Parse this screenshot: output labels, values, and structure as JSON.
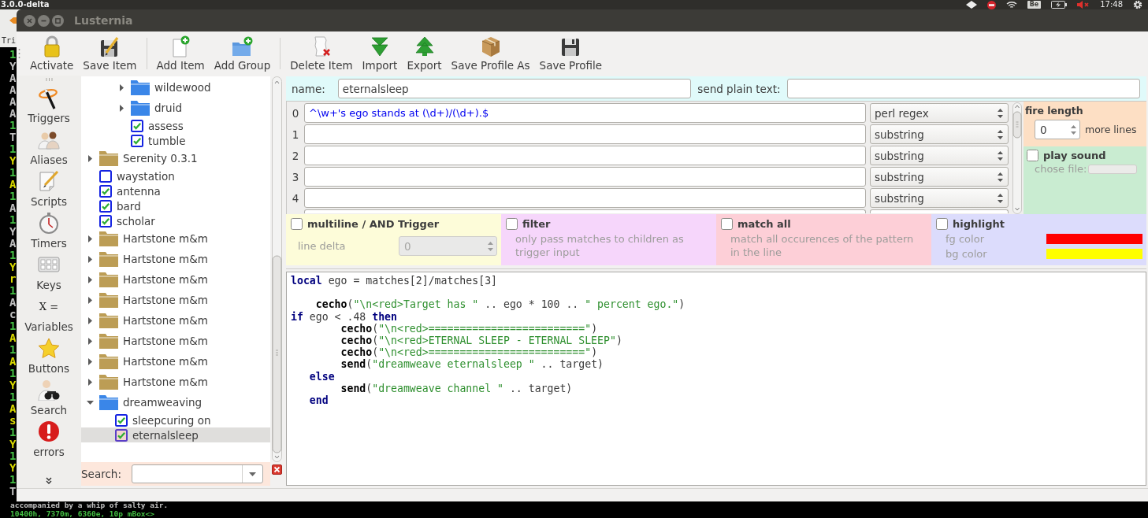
{
  "desktop_panel": {
    "title": "3.0.0-delta",
    "keyboard_layout": "Be",
    "clock": "17:48"
  },
  "background_app": {
    "tab_label": "Tri",
    "terminal_edge": [
      {
        "text": "1",
        "color": "#44c044"
      },
      {
        "text": "Y",
        "color": "#c0c0c0"
      },
      {
        "text": "A",
        "color": "#c0c0c0"
      },
      {
        "text": "A",
        "color": "#c0c0c0"
      },
      {
        "text": "A",
        "color": "#c0c0c0"
      },
      {
        "text": "A",
        "color": "#c0c0c0"
      },
      {
        "text": "1",
        "color": "#44c044"
      },
      {
        "text": "T",
        "color": "#c0c0c0"
      },
      {
        "text": "1",
        "color": "#44c044"
      },
      {
        "text": "Y",
        "color": "#d8d800"
      },
      {
        "text": "1",
        "color": "#44c044"
      },
      {
        "text": "A",
        "color": "#d8d800"
      },
      {
        "text": "1",
        "color": "#44c044"
      },
      {
        "text": "A",
        "color": "#c0c0c0"
      },
      {
        "text": "1",
        "color": "#44c044"
      },
      {
        "text": "Y",
        "color": "#c0c0c0"
      },
      {
        "text": "A",
        "color": "#c0c0c0"
      },
      {
        "text": "1",
        "color": "#44c044"
      },
      {
        "text": "Y",
        "color": "#d8d800"
      },
      {
        "text": "r",
        "color": "#d8d800"
      },
      {
        "text": "1",
        "color": "#44c044"
      },
      {
        "text": "A",
        "color": "#c0c0c0"
      },
      {
        "text": "c",
        "color": "#c0c0c0"
      },
      {
        "text": "1",
        "color": "#44c044"
      },
      {
        "text": "A",
        "color": "#d8d800"
      },
      {
        "text": "1",
        "color": "#44c044"
      },
      {
        "text": "A",
        "color": "#d8d800"
      },
      {
        "text": "1",
        "color": "#44c044"
      },
      {
        "text": "Y",
        "color": "#d8d800"
      },
      {
        "text": "1",
        "color": "#44c044"
      },
      {
        "text": "A",
        "color": "#d8d800"
      },
      {
        "text": "s",
        "color": "#d8d800"
      },
      {
        "text": "1",
        "color": "#44c044"
      },
      {
        "text": "Y",
        "color": "#d8d800"
      },
      {
        "text": "1",
        "color": "#44c044"
      },
      {
        "text": "Y",
        "color": "#d8d800"
      },
      {
        "text": "1",
        "color": "#44c044"
      },
      {
        "text": "T",
        "color": "#c0c0c0"
      }
    ],
    "terminal_lines": [
      {
        "text": "accompanied by a whip of salty air.",
        "color": "#c0c0c0"
      },
      {
        "text": "10400h, 7370m, 6360e, 10p mBox<>",
        "color": "#44c044"
      }
    ]
  },
  "window": {
    "title": "Lusternia"
  },
  "toolbar": {
    "items": [
      {
        "kind": "button",
        "label": "Activate"
      },
      {
        "kind": "button",
        "label": "Save Item"
      },
      {
        "kind": "separator"
      },
      {
        "kind": "button",
        "label": "Add Item"
      },
      {
        "kind": "button",
        "label": "Add Group"
      },
      {
        "kind": "separator"
      },
      {
        "kind": "button",
        "label": "Delete Item"
      },
      {
        "kind": "button",
        "label": "Import"
      },
      {
        "kind": "button",
        "label": "Export"
      },
      {
        "kind": "button",
        "label": "Save Profile As"
      },
      {
        "kind": "button",
        "label": "Save Profile"
      }
    ]
  },
  "sidebar": {
    "items": [
      {
        "label": "Triggers"
      },
      {
        "label": "Aliases"
      },
      {
        "label": "Scripts"
      },
      {
        "label": "Timers"
      },
      {
        "label": "Keys"
      },
      {
        "label": "Variables",
        "icon_text": "X ="
      },
      {
        "label": "Buttons"
      },
      {
        "label": "Search"
      },
      {
        "label": "errors"
      }
    ]
  },
  "tree": {
    "items": [
      {
        "kind": "scrolled_off",
        "children": [
          {
            "kind": "scrolled_off",
            "children": [
              {
                "kind": "folder",
                "label": "wildewood",
                "color": "#3a86e8",
                "expanded": false,
                "selected": false
              },
              {
                "kind": "folder",
                "label": "druid",
                "color": "#3a86e8",
                "expanded": false,
                "selected": false
              },
              {
                "kind": "item",
                "label": "assess",
                "checked": true,
                "selected": false
              },
              {
                "kind": "item",
                "label": "tumble",
                "checked": true,
                "selected": false
              }
            ]
          }
        ]
      },
      {
        "kind": "folder",
        "label": "Serenity 0.3.1",
        "color": "#bc9d55",
        "expanded": false,
        "selected": false
      },
      {
        "kind": "item",
        "label": "waystation",
        "checked": false,
        "selected": false
      },
      {
        "kind": "item",
        "label": "antenna",
        "checked": true,
        "selected": false
      },
      {
        "kind": "item",
        "label": "bard",
        "checked": true,
        "selected": false
      },
      {
        "kind": "item",
        "label": "scholar",
        "checked": true,
        "selected": false
      },
      {
        "kind": "folder",
        "label": "Hartstone m&m",
        "color": "#bc9d55",
        "expanded": false,
        "selected": false
      },
      {
        "kind": "folder",
        "label": "Hartstone m&m",
        "color": "#bc9d55",
        "expanded": false,
        "selected": false
      },
      {
        "kind": "folder",
        "label": "Hartstone m&m",
        "color": "#bc9d55",
        "expanded": false,
        "selected": false
      },
      {
        "kind": "folder",
        "label": "Hartstone m&m",
        "color": "#bc9d55",
        "expanded": false,
        "selected": false
      },
      {
        "kind": "folder",
        "label": "Hartstone m&m",
        "color": "#bc9d55",
        "expanded": false,
        "selected": false
      },
      {
        "kind": "folder",
        "label": "Hartstone m&m",
        "color": "#bc9d55",
        "expanded": false,
        "selected": false
      },
      {
        "kind": "folder",
        "label": "Hartstone m&m",
        "color": "#bc9d55",
        "expanded": false,
        "selected": false
      },
      {
        "kind": "folder",
        "label": "Hartstone m&m",
        "color": "#bc9d55",
        "expanded": false,
        "selected": false
      },
      {
        "kind": "folder",
        "label": "dreamweaving",
        "color": "#3a86e8",
        "expanded": true,
        "selected": false,
        "children": [
          {
            "kind": "item",
            "label": "sleepcuring on",
            "checked": true,
            "selected": false
          },
          {
            "kind": "item",
            "label": "eternalsleep",
            "checked": true,
            "selected": true
          }
        ]
      }
    ],
    "search": {
      "label": "Search:"
    }
  },
  "trigger": {
    "name": {
      "label": "name:",
      "value": "eternalsleep"
    },
    "send_plain_text": {
      "label": "send plain text:"
    },
    "patterns": {
      "rows": [
        {
          "number": "0",
          "pattern": "^\\w+'s ego stands at (\\d+)/(\\d+).$",
          "kind": "regex",
          "type": "perl regex"
        },
        {
          "number": "1",
          "kind": "substring",
          "type": "substring"
        },
        {
          "number": "2",
          "kind": "substring",
          "type": "substring"
        },
        {
          "number": "3",
          "kind": "substring",
          "type": "substring"
        },
        {
          "number": "4",
          "kind": "substring",
          "type": "substring"
        }
      ],
      "cut_off_row": true
    },
    "fire_length": {
      "title": "fire length",
      "value": "0",
      "unit": "more lines"
    },
    "play_sound": {
      "label": "play sound",
      "checked": false,
      "file_label": "chose file:",
      "file_disabled": true
    },
    "options": [
      {
        "kind": "multiline",
        "label": "multiline / AND Trigger",
        "checked": false,
        "field_label": "line delta",
        "value": "0",
        "disabled": true
      },
      {
        "kind": "filter",
        "label": "filter",
        "checked": false,
        "description": "only pass matches to children as trigger input"
      },
      {
        "kind": "match_all",
        "label": "match all",
        "checked": false,
        "description": "match all occurences of the pattern in the line"
      },
      {
        "kind": "highlight",
        "label": "highlight",
        "checked": false,
        "fg": {
          "label": "fg color",
          "color": "#ff0000"
        },
        "bg": {
          "label": "bg color",
          "color": "#ffff00"
        }
      }
    ]
  },
  "script": {
    "lines": [
      {
        "kind": "code",
        "tokens": [
          {
            "kind": "keyword",
            "text": "local"
          },
          {
            "kind": "plain",
            "text": " ego = matches[2]/matches[3]"
          }
        ]
      },
      {
        "kind": "blank"
      },
      {
        "kind": "code",
        "tokens": [
          {
            "kind": "function",
            "text": "    cecho"
          },
          {
            "kind": "plain",
            "text": "("
          },
          {
            "kind": "string",
            "text": "\"\\n<red>Target has \""
          },
          {
            "kind": "plain",
            "text": " .. ego * "
          },
          {
            "kind": "number",
            "text": "100"
          },
          {
            "kind": "plain",
            "text": " .. "
          },
          {
            "kind": "string",
            "text": "\" percent ego.\""
          },
          {
            "kind": "plain",
            "text": ")"
          }
        ]
      },
      {
        "kind": "code",
        "tokens": [
          {
            "kind": "keyword",
            "text": "if"
          },
          {
            "kind": "plain",
            "text": " ego < "
          },
          {
            "kind": "number",
            "text": ".48"
          },
          {
            "kind": "keyword",
            "text": " then"
          }
        ]
      },
      {
        "kind": "code",
        "tokens": [
          {
            "kind": "function",
            "text": "        cecho"
          },
          {
            "kind": "plain",
            "text": "("
          },
          {
            "kind": "string",
            "text": "\"\\n<red>=========================\""
          },
          {
            "kind": "plain",
            "text": ")"
          }
        ]
      },
      {
        "kind": "code",
        "tokens": [
          {
            "kind": "function",
            "text": "        cecho"
          },
          {
            "kind": "plain",
            "text": "("
          },
          {
            "kind": "string",
            "text": "\"\\n<red>ETERNAL SLEEP - ETERNAL SLEEP\""
          },
          {
            "kind": "plain",
            "text": ")"
          }
        ]
      },
      {
        "kind": "code",
        "tokens": [
          {
            "kind": "function",
            "text": "        cecho"
          },
          {
            "kind": "plain",
            "text": "("
          },
          {
            "kind": "string",
            "text": "\"\\n<red>=========================\""
          },
          {
            "kind": "plain",
            "text": ")"
          }
        ]
      },
      {
        "kind": "code",
        "tokens": [
          {
            "kind": "function",
            "text": "        send"
          },
          {
            "kind": "plain",
            "text": "("
          },
          {
            "kind": "string",
            "text": "\"dreamweave eternalsleep \""
          },
          {
            "kind": "plain",
            "text": " .. target)"
          }
        ]
      },
      {
        "kind": "code",
        "tokens": [
          {
            "kind": "keyword",
            "text": "   else"
          }
        ]
      },
      {
        "kind": "code",
        "tokens": [
          {
            "kind": "function",
            "text": "        send"
          },
          {
            "kind": "plain",
            "text": "("
          },
          {
            "kind": "string",
            "text": "\"dreamweave channel \""
          },
          {
            "kind": "plain",
            "text": " .. target)"
          }
        ]
      },
      {
        "kind": "code",
        "tokens": [
          {
            "kind": "keyword",
            "text": "   end"
          }
        ]
      }
    ]
  }
}
